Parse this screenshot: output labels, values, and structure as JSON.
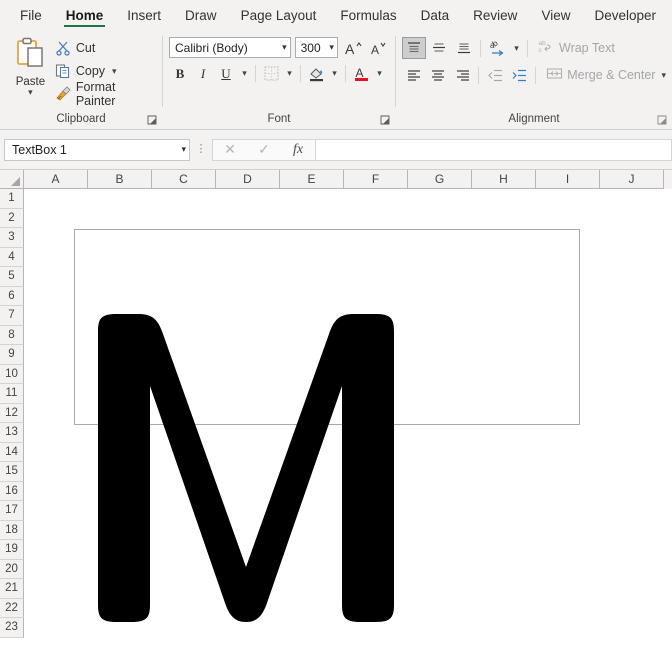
{
  "window": {
    "app": "Excel"
  },
  "tabs": [
    {
      "label": "File",
      "active": false
    },
    {
      "label": "Home",
      "active": true
    },
    {
      "label": "Insert",
      "active": false
    },
    {
      "label": "Draw",
      "active": false
    },
    {
      "label": "Page Layout",
      "active": false
    },
    {
      "label": "Formulas",
      "active": false
    },
    {
      "label": "Data",
      "active": false
    },
    {
      "label": "Review",
      "active": false
    },
    {
      "label": "View",
      "active": false
    },
    {
      "label": "Developer",
      "active": false
    }
  ],
  "ribbon": {
    "clipboard": {
      "group_label": "Clipboard",
      "paste_label": "Paste",
      "paste_icon": "clipboard-icon",
      "cut_label": "Cut",
      "cut_icon": "scissors-icon",
      "copy_label": "Copy",
      "copy_icon": "copy-icon",
      "format_painter_label": "Format Painter",
      "format_painter_icon": "paintbrush-icon",
      "launcher_icon": "dialog-launcher-icon"
    },
    "font": {
      "group_label": "Font",
      "font_name": "Calibri (Body)",
      "font_size": "300",
      "grow_font_icon": "grow-font-icon",
      "shrink_font_icon": "shrink-font-icon",
      "bold_label": "B",
      "italic_label": "I",
      "underline_label": "U",
      "borders_icon": "borders-icon",
      "fill_color_icon": "fill-color-icon",
      "font_color_icon": "font-color-icon",
      "font_color_swatch": "#e81123",
      "launcher_icon": "dialog-launcher-icon"
    },
    "alignment": {
      "group_label": "Alignment",
      "align_top_icon": "align-top-icon",
      "align_middle_icon": "align-middle-icon",
      "align_bottom_icon": "align-bottom-icon",
      "orientation_icon": "text-orientation-icon",
      "wrap_text_label": "Wrap Text",
      "wrap_text_icon": "wrap-text-icon",
      "align_left_icon": "align-left-icon",
      "align_center_icon": "align-center-icon",
      "align_right_icon": "align-right-icon",
      "decrease_indent_icon": "decrease-indent-icon",
      "increase_indent_icon": "increase-indent-icon",
      "merge_center_label": "Merge & Center",
      "merge_center_icon": "merge-cells-icon",
      "launcher_icon": "dialog-launcher-icon",
      "selected_vertical": "align-top-icon"
    }
  },
  "formula_bar": {
    "name_box_value": "TextBox 1",
    "name_box_caret_icon": "chevron-down-icon",
    "cancel_icon": "cancel-x-icon",
    "enter_icon": "confirm-check-icon",
    "function_icon": "insert-function-icon",
    "function_label": "fx",
    "formula_value": "",
    "overflow_icon": "more-options-icon"
  },
  "grid": {
    "columns": [
      "A",
      "B",
      "C",
      "D",
      "E",
      "F",
      "G",
      "H",
      "I",
      "J"
    ],
    "rows": [
      "1",
      "2",
      "3",
      "4",
      "5",
      "6",
      "7",
      "8",
      "9",
      "10",
      "11",
      "12",
      "13",
      "14",
      "15",
      "16",
      "17",
      "18",
      "19",
      "20",
      "21",
      "22",
      "23"
    ],
    "gridlines_visible": false,
    "select_all_icon": "select-all-corner-icon"
  },
  "canvas": {
    "shape_name": "TextBox 1",
    "shape_border_color": "#a9a9a9",
    "text_content": "M",
    "text_color": "#000000",
    "text_font": "Calibri (Body)",
    "text_size_pt": "300"
  }
}
